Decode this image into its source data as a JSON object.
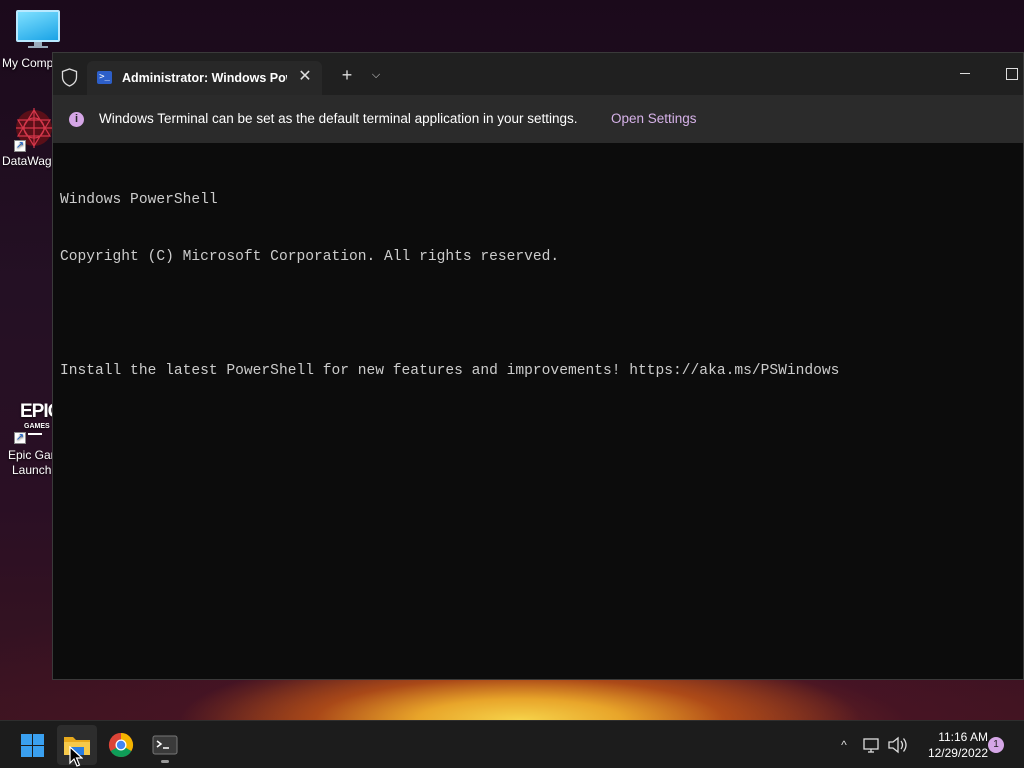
{
  "desktop": {
    "icons": [
      {
        "label_line1": "My Comp",
        "label_line2": "",
        "icon": "monitor-icon"
      },
      {
        "label_line1": "DataWag",
        "label_line2": "",
        "icon": "datawag-icon"
      },
      {
        "label_line1": "Epic Gar",
        "label_line2": "Launch",
        "icon": "epic-games-icon",
        "logo_text": "EPIC",
        "logo_sub": "GAMES"
      }
    ]
  },
  "window": {
    "tab_title": "Administrator: Windows PowerShell",
    "tab_icon_glyph": ">_",
    "new_tab_glyph": "+",
    "dropdown_glyph": "⌵",
    "close_glyph": "✕",
    "infobar": {
      "icon_glyph": "i",
      "message": "Windows Terminal can be set as the default terminal application in your settings.",
      "link": "Open Settings"
    },
    "console_lines": [
      "Windows PowerShell",
      "Copyright (C) Microsoft Corporation. All rights reserved.",
      "",
      "Install the latest PowerShell for new features and improvements! https://aka.ms/PSWindows"
    ]
  },
  "taskbar": {
    "apps": [
      "start-button",
      "file-explorer",
      "chrome",
      "terminal"
    ],
    "tray_chevron": "^",
    "clock_time": "11:16 AM",
    "clock_date": "12/29/2022",
    "notification_count": "1"
  },
  "colors": {
    "accent_pink": "#d5a6e6",
    "terminal_bg": "#0c0c0c",
    "titlebar_bg": "#202020",
    "windows_blue": "#3aa0f0"
  }
}
